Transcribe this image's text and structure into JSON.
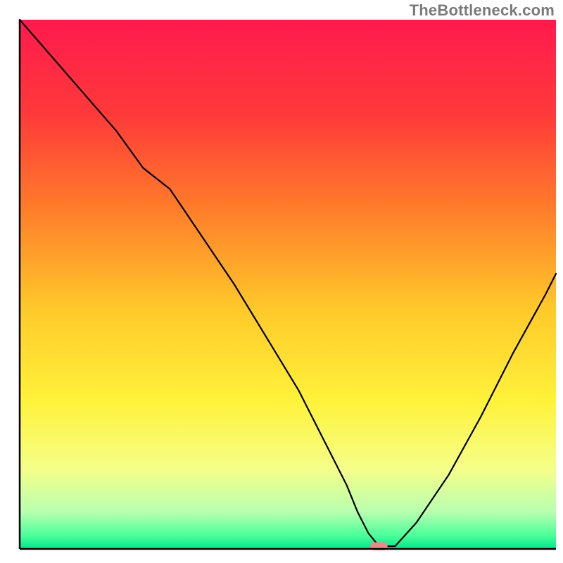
{
  "watermark": "TheBottleneck.com",
  "chart_data": {
    "type": "line",
    "title": "",
    "xlabel": "",
    "ylabel": "",
    "xlim": [
      0,
      100
    ],
    "ylim": [
      0,
      100
    ],
    "grid": false,
    "legend": false,
    "background": {
      "description": "vertical gradient from red (top) through orange and yellow to green (bottom)",
      "stops": [
        {
          "offset": 0.0,
          "color": "#ff1a4d"
        },
        {
          "offset": 0.18,
          "color": "#ff3a3a"
        },
        {
          "offset": 0.35,
          "color": "#ff7a2a"
        },
        {
          "offset": 0.55,
          "color": "#ffca2a"
        },
        {
          "offset": 0.72,
          "color": "#fff23a"
        },
        {
          "offset": 0.85,
          "color": "#f4ff8a"
        },
        {
          "offset": 0.93,
          "color": "#b8ffb0"
        },
        {
          "offset": 0.975,
          "color": "#4aff9a"
        },
        {
          "offset": 1.0,
          "color": "#00e58a"
        }
      ]
    },
    "series": [
      {
        "name": "bottleneck-curve",
        "color": "#000000",
        "stroke_width": 2.2,
        "x": [
          0,
          6,
          12,
          18,
          23,
          28,
          34,
          40,
          46,
          52,
          57,
          61,
          63,
          65,
          67,
          70,
          74,
          80,
          86,
          92,
          98,
          100
        ],
        "y": [
          100,
          93,
          86,
          79,
          72,
          68,
          59,
          50,
          40,
          30,
          20,
          12,
          7,
          3,
          0.5,
          0.5,
          5,
          14,
          25,
          37,
          48,
          52
        ]
      }
    ],
    "markers": [
      {
        "name": "optimal-point",
        "shape": "pill",
        "color": "#e88a8a",
        "x": 67,
        "y": 0.5,
        "width_units": 3.2,
        "height_units": 1.5
      }
    ],
    "axes": {
      "show_ticks": false,
      "frame_color": "#000000",
      "frame_width": 2.5
    }
  }
}
